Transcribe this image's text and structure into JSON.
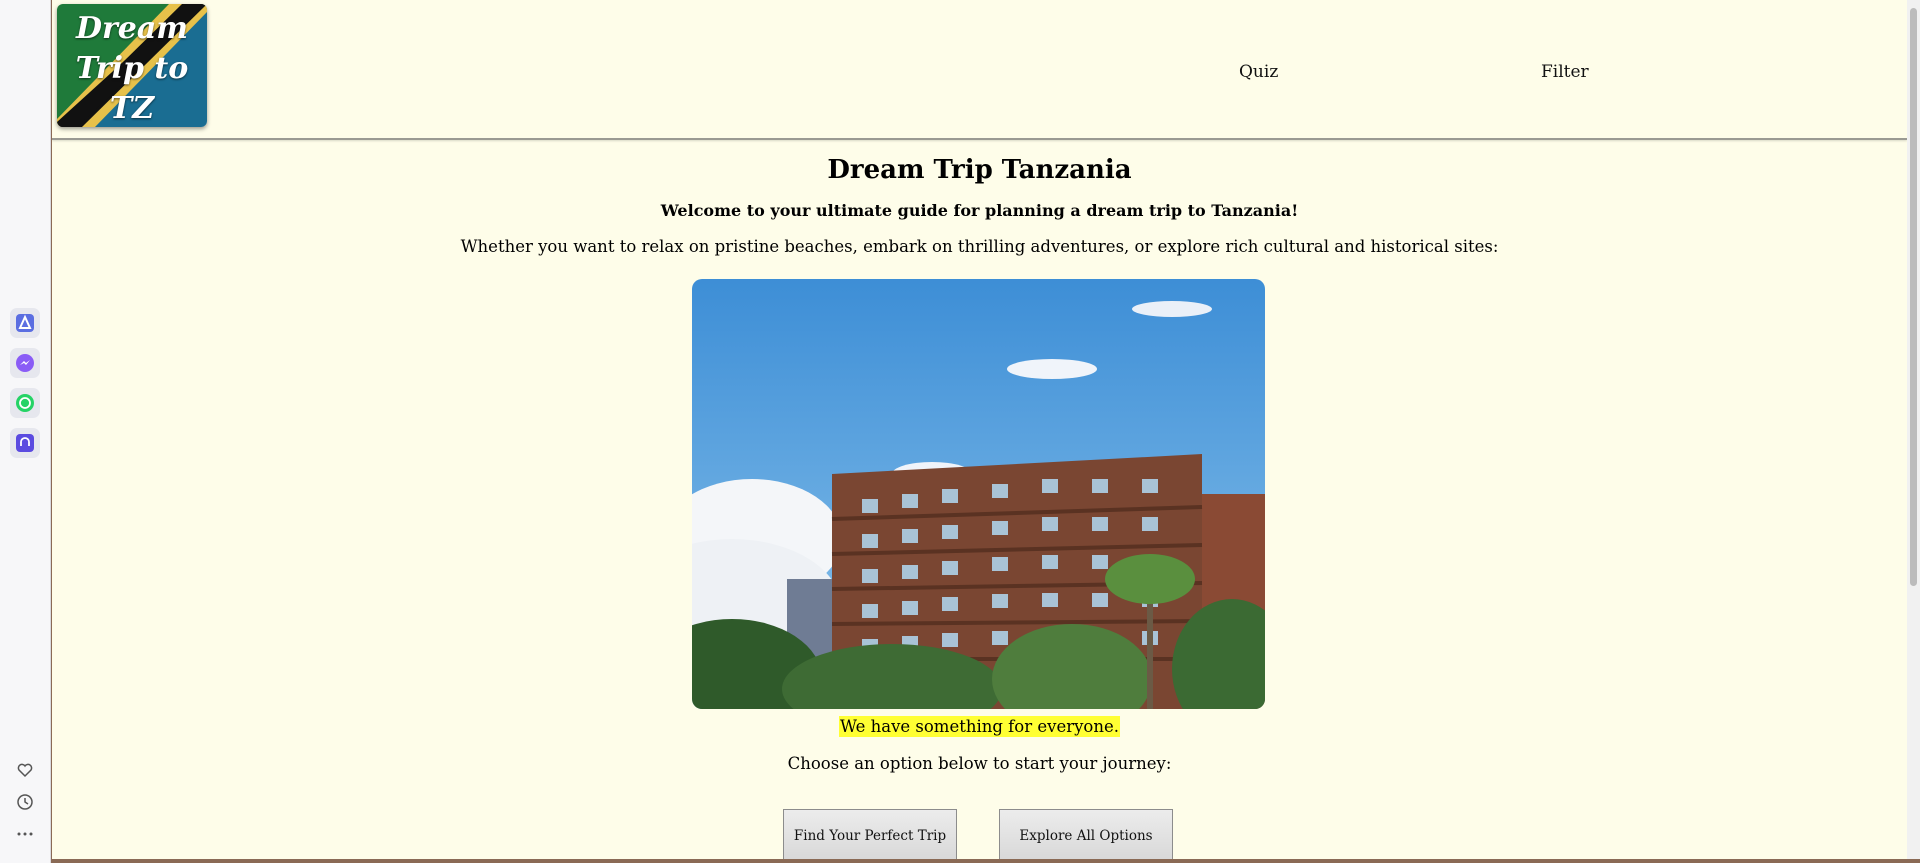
{
  "logo": {
    "text": "Dream Trip to TZ"
  },
  "nav": {
    "items": [
      {
        "label": "Quiz"
      },
      {
        "label": "Filter"
      }
    ]
  },
  "main": {
    "title": "Dream Trip Tanzania",
    "welcome": "Welcome to your ultimate guide for planning a dream trip to Tanzania!",
    "intro": "Whether you want to relax on pristine beaches, embark on thrilling adventures, or explore rich cultural and historical sites:",
    "tagline": "We have something for everyone.",
    "choose": "Choose an option below to start your journey:",
    "buttons": {
      "find": "Find Your Perfect Trip",
      "explore": "Explore All Options"
    }
  },
  "sidebar": {
    "apps": [
      {
        "icon": "maps-app-icon",
        "color": "#5b6ee1"
      },
      {
        "icon": "messenger-icon",
        "color": "#8a5cf6"
      },
      {
        "icon": "whatsapp-icon",
        "color": "#25d366"
      },
      {
        "icon": "music-app-icon",
        "color": "#5b4be0"
      }
    ],
    "utilities": [
      {
        "icon": "heart-icon"
      },
      {
        "icon": "history-icon"
      },
      {
        "icon": "more-icon"
      }
    ]
  },
  "colors": {
    "page_bg": "#fefde9",
    "tagline_highlight": "#ffff33"
  }
}
